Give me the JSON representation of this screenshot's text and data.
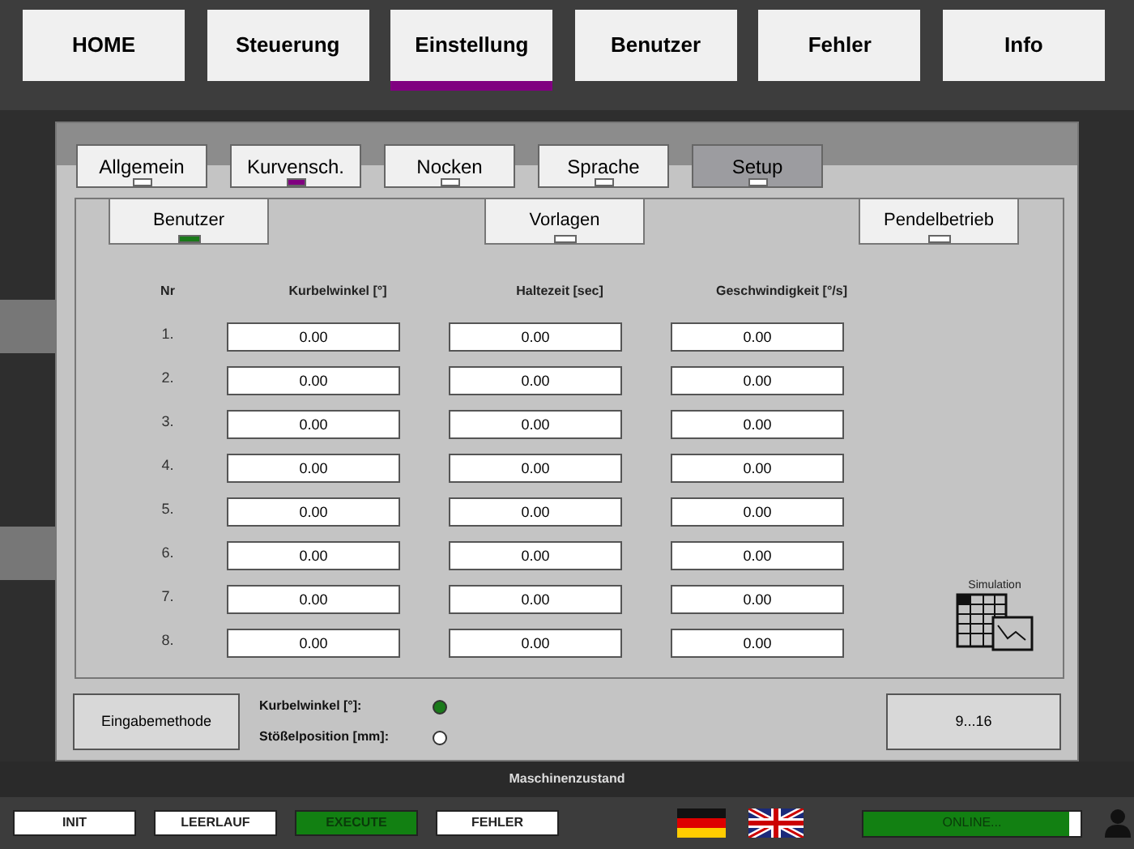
{
  "nav": [
    {
      "label": "HOME",
      "selected": false
    },
    {
      "label": "Steuerung",
      "selected": false
    },
    {
      "label": "Einstellung",
      "selected": true
    },
    {
      "label": "Benutzer",
      "selected": false
    },
    {
      "label": "Fehler",
      "selected": false
    },
    {
      "label": "Info",
      "selected": false
    }
  ],
  "tabs": [
    {
      "label": "Allgemein",
      "selected": false,
      "marked": false
    },
    {
      "label": "Kurvensch.",
      "selected": false,
      "marked": true
    },
    {
      "label": "Nocken",
      "selected": false,
      "marked": false
    },
    {
      "label": "Sprache",
      "selected": false,
      "marked": false
    },
    {
      "label": "Setup",
      "selected": true,
      "marked": false
    }
  ],
  "subtabs": [
    {
      "label": "Benutzer",
      "marked": true
    },
    {
      "label": "Vorlagen",
      "marked": false
    },
    {
      "label": "Pendelbetrieb",
      "marked": false
    }
  ],
  "table": {
    "columns": [
      "Nr",
      "Kurbelwinkel [°]",
      "Haltezeit [sec]",
      "Geschwindigkeit [°/s]"
    ],
    "rows": [
      [
        "1.",
        "0.00",
        "0.00",
        "0.00"
      ],
      [
        "2.",
        "0.00",
        "0.00",
        "0.00"
      ],
      [
        "3.",
        "0.00",
        "0.00",
        "0.00"
      ],
      [
        "4.",
        "0.00",
        "0.00",
        "0.00"
      ],
      [
        "5.",
        "0.00",
        "0.00",
        "0.00"
      ],
      [
        "6.",
        "0.00",
        "0.00",
        "0.00"
      ],
      [
        "7.",
        "0.00",
        "0.00",
        "0.00"
      ],
      [
        "8.",
        "0.00",
        "0.00",
        "0.00"
      ]
    ]
  },
  "simulation": {
    "label": "Simulation"
  },
  "input_method": {
    "button": "Eingabemethode",
    "options": [
      {
        "label": "Kurbelwinkel [°]:",
        "selected": true
      },
      {
        "label": "Stößelposition [mm]:",
        "selected": false
      }
    ]
  },
  "page_button": "9...16",
  "machine_state": {
    "title": "Maschinenzustand",
    "states": [
      {
        "label": "INIT",
        "selected": false
      },
      {
        "label": "LEERLAUF",
        "selected": false
      },
      {
        "label": "EXECUTE",
        "selected": true
      },
      {
        "label": "FEHLER",
        "selected": false
      }
    ]
  },
  "connection": {
    "label": "ONLINE...",
    "level": 0.95
  }
}
